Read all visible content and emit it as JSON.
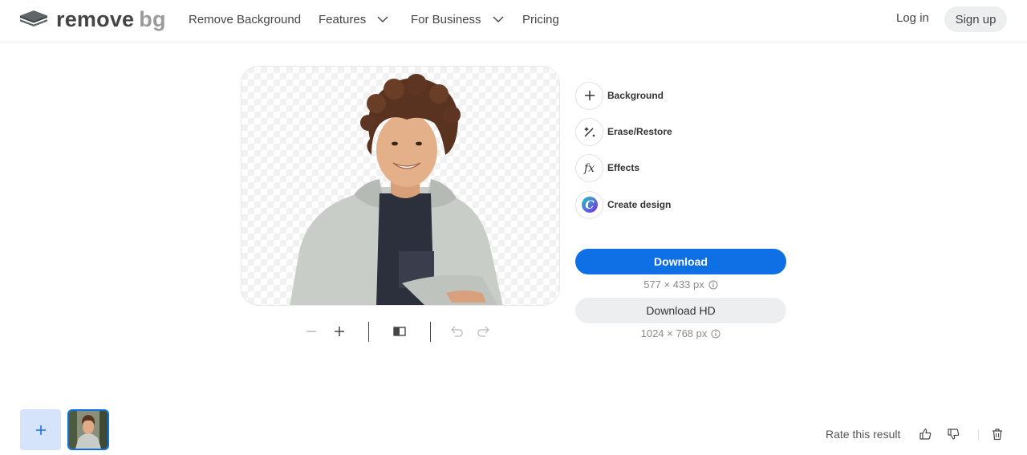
{
  "header": {
    "logo": {
      "part1": "remove",
      "part2": "bg"
    },
    "nav": {
      "remove_background": "Remove Background",
      "features": "Features",
      "for_business": "For Business",
      "pricing": "Pricing"
    },
    "login": "Log in",
    "signup": "Sign up"
  },
  "editor": {
    "tools": [
      {
        "label": "Background",
        "icon": "plus-icon"
      },
      {
        "label": "Erase/Restore",
        "icon": "magic-brush-icon"
      },
      {
        "label": "Effects",
        "icon": "fx-icon"
      },
      {
        "label": "Create design",
        "icon": "canva-logo-icon"
      }
    ],
    "download": {
      "label": "Download",
      "dims": "577 × 433 px"
    },
    "download_hd": {
      "label": "Download HD",
      "dims": "1024 × 768 px"
    },
    "toolbar": {
      "icons": [
        "zoom-out-icon",
        "zoom-in-icon",
        "compare-icon",
        "undo-icon",
        "redo-icon"
      ]
    }
  },
  "footer": {
    "rate_label": "Rate this result"
  },
  "colors": {
    "primary": "#0f70e6",
    "text": "#454545",
    "muted_button": "#eceef0",
    "upload_bg": "#d6e4fb"
  }
}
